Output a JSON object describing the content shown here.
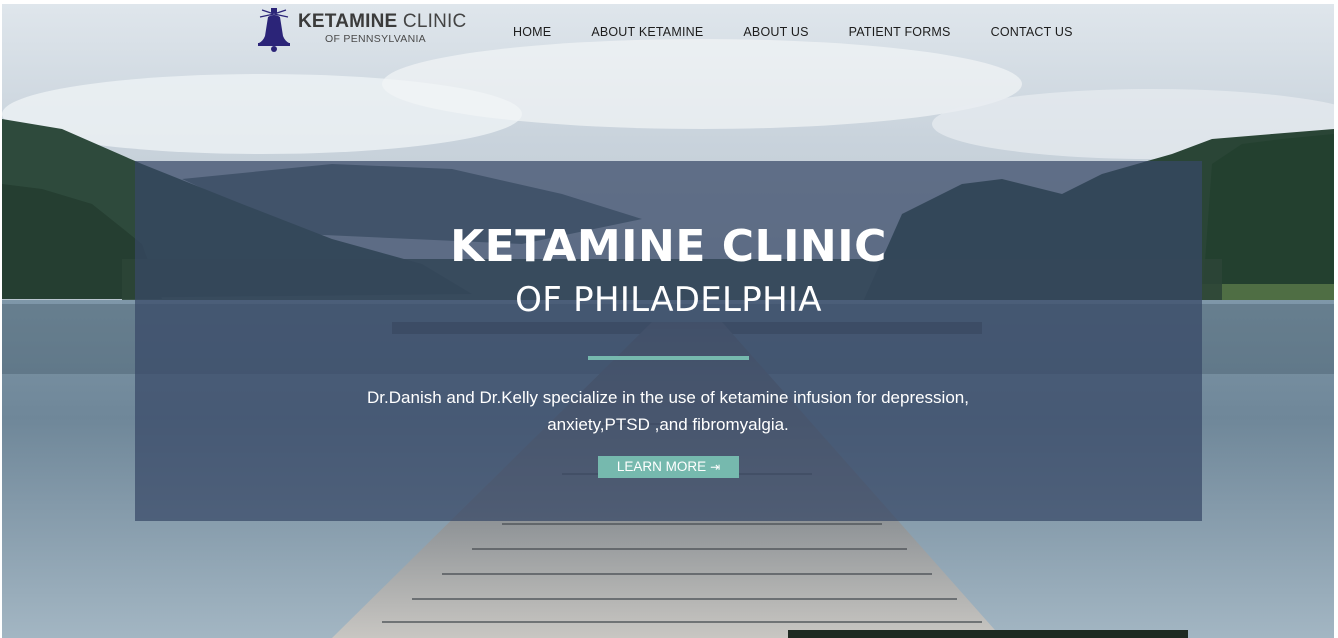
{
  "logo": {
    "name_bold": "KETAMINE",
    "name_light": "CLINIC",
    "tagline": "OF PENNSYLVANIA",
    "icon": "liberty-bell-icon",
    "color": "#2b2478"
  },
  "nav": {
    "items": [
      {
        "label": "HOME"
      },
      {
        "label": "ABOUT KETAMINE"
      },
      {
        "label": "ABOUT US"
      },
      {
        "label": "PATIENT FORMS"
      },
      {
        "label": "CONTACT US"
      }
    ]
  },
  "hero": {
    "title": "KETAMINE CLINIC",
    "subtitle": "OF PHILADELPHIA",
    "description_line1": "Dr.Danish and Dr.Kelly specialize in the use of ketamine infusion for depression,",
    "description_line2": "anxiety,PTSD ,and fibromyalgia.",
    "button_label": "LEARN MORE",
    "button_icon": "arrow-right-icon",
    "accent_color": "#76b9ae",
    "panel_color": "#384866"
  }
}
